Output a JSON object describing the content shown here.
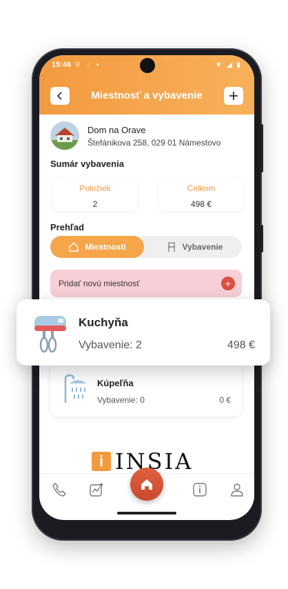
{
  "status": {
    "time": "15:46"
  },
  "header": {
    "title": "Miestnosť a vybavenie",
    "back_icon": "chevron-left-icon",
    "add_icon": "plus-icon"
  },
  "property": {
    "name": "Dom na Orave",
    "address": "Štefánikova 258, 029 01 Námestovo"
  },
  "summary": {
    "title": "Sumár vybavenia",
    "items_label": "Položiek",
    "items_value": "2",
    "total_label": "Celkom",
    "total_value": "498 €"
  },
  "overview": {
    "title": "Prehľad",
    "tab_rooms": "Miestnosti",
    "tab_equipment": "Vybavenie",
    "active_tab": "Miestnosti"
  },
  "add_room": {
    "label": "Pridať novú miestnosť"
  },
  "rooms": [
    {
      "name": "Kuchyňa",
      "equipment": "Vybavenie: 2",
      "price": "498 €",
      "icon": "mixer-icon"
    },
    {
      "name": "Kúpeľňa",
      "equipment": "Vybavenie: 0",
      "price": "0 €",
      "icon": "shower-icon"
    }
  ],
  "brand": {
    "mark": "i",
    "name": "INSIA"
  },
  "colors": {
    "accent": "#F39A3F",
    "add_room_bg": "#F8CFD6",
    "home_button": "#D9553A"
  }
}
